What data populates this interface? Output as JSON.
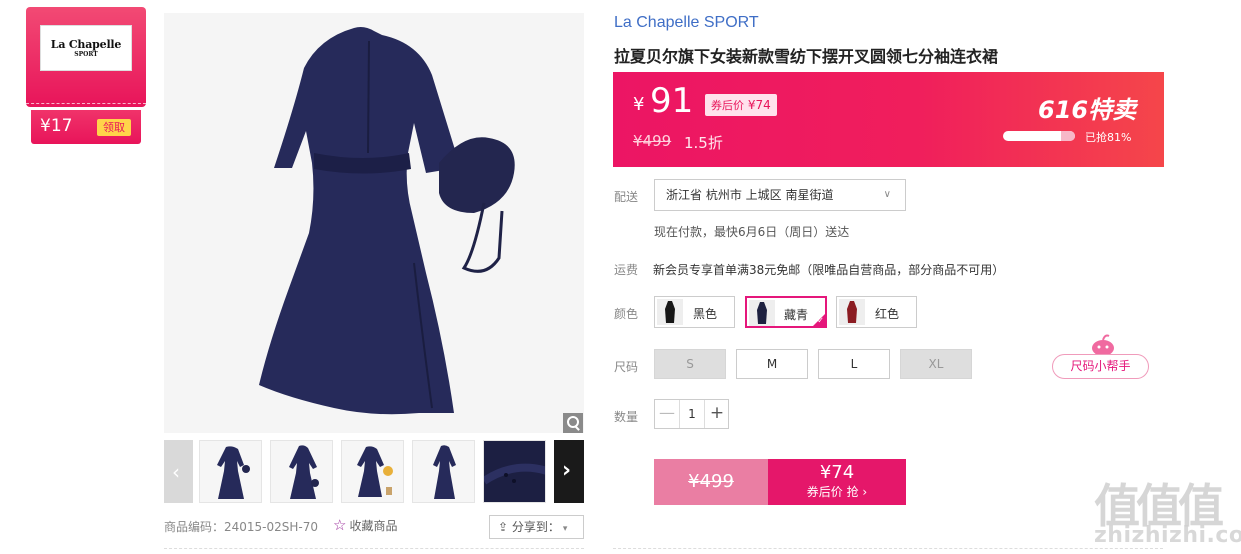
{
  "coupon": {
    "logo_line1": "La Chapelle",
    "logo_line2": "SPORT",
    "amount": "¥17",
    "claim_label": "领取"
  },
  "gallery": {
    "thumbnail_count": 5,
    "zoom_icon": "zoom-icon",
    "prev_icon": "chevron-left-icon",
    "next_icon": "chevron-right-icon",
    "prev_glyph": "‹",
    "next_glyph": "›"
  },
  "meta": {
    "product_code": "商品编码：24015-02SH-70",
    "favorite_label": "收藏商品",
    "share_label": "分享到：",
    "share_glyph": "▾"
  },
  "product": {
    "brand": "La Chapelle SPORT",
    "title": "拉夏贝尔旗下女装新款雪纺下摆开叉圆领七分袖连衣裙"
  },
  "pricing": {
    "currency": "¥",
    "price": "91",
    "after_coupon_label": "券后价",
    "after_coupon_price": "¥74",
    "original_price": "¥499",
    "discount": "1.5折",
    "promo_label": "616特卖",
    "sold_text": "已抢81%",
    "sold_fraction": 0.81,
    "brand_color": "#e8145a"
  },
  "options": {
    "delivery_label": "配送",
    "delivery_value": "浙江省 杭州市 上城区 南星街道",
    "delivery_chevron": "∨",
    "delivery_note": "现在付款，最快6月6日（周日）送达",
    "shipping_label": "运费",
    "shipping_text": "新会员专享首单满38元免邮（限唯品自营商品，部分商品不可用）",
    "color_label": "颜色",
    "colors": [
      {
        "label": "黑色",
        "swatch": "#161616",
        "selected": false
      },
      {
        "label": "藏青",
        "swatch": "#1e2140",
        "selected": true
      },
      {
        "label": "红色",
        "swatch": "#8b1c22",
        "selected": false
      }
    ],
    "check_glyph": "✓",
    "size_label": "尺码",
    "sizes": [
      {
        "label": "S",
        "disabled": true
      },
      {
        "label": "M",
        "disabled": false
      },
      {
        "label": "L",
        "disabled": false
      },
      {
        "label": "XL",
        "disabled": true
      }
    ],
    "size_helper": "尺码小帮手",
    "qty_label": "数量",
    "qty_minus": "—",
    "qty_value": "1",
    "qty_plus": "+"
  },
  "buy": {
    "original_price": "¥499",
    "coupon_price": "¥74",
    "coupon_action": "券后价 抢 ›"
  },
  "watermark": {
    "glyphs": "值值值",
    "url": "zhizhizhi.com"
  }
}
